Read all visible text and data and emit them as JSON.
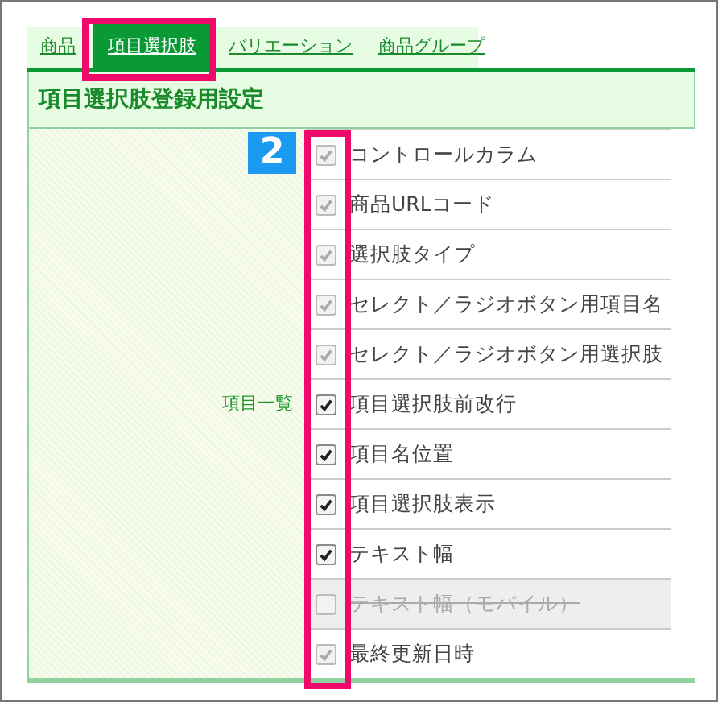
{
  "tabs": [
    {
      "label": "商品",
      "selected": false
    },
    {
      "label": "項目選択肢",
      "selected": true
    },
    {
      "label": "バリエーション",
      "selected": false
    },
    {
      "label": "商品グループ",
      "selected": false
    }
  ],
  "section_title": "項目選択肢登録用設定",
  "step_badge": "2",
  "field_label": "項目一覧",
  "items": [
    {
      "label": "コントロールカラム",
      "checked": true,
      "disabled": true,
      "struck": false
    },
    {
      "label": "商品URLコード",
      "checked": true,
      "disabled": true,
      "struck": false
    },
    {
      "label": "選択肢タイプ",
      "checked": true,
      "disabled": true,
      "struck": false
    },
    {
      "label": "セレクト／ラジオボタン用項目名",
      "checked": true,
      "disabled": true,
      "struck": false
    },
    {
      "label": "セレクト／ラジオボタン用選択肢",
      "checked": true,
      "disabled": true,
      "struck": false
    },
    {
      "label": "項目選択肢前改行",
      "checked": true,
      "disabled": false,
      "struck": false
    },
    {
      "label": "項目名位置",
      "checked": true,
      "disabled": false,
      "struck": false
    },
    {
      "label": "項目選択肢表示",
      "checked": true,
      "disabled": false,
      "struck": false
    },
    {
      "label": "テキスト幅",
      "checked": true,
      "disabled": false,
      "struck": false
    },
    {
      "label": "テキスト幅（モバイル）",
      "checked": false,
      "disabled": true,
      "struck": true
    },
    {
      "label": "最終更新日時",
      "checked": true,
      "disabled": true,
      "struck": false
    }
  ]
}
